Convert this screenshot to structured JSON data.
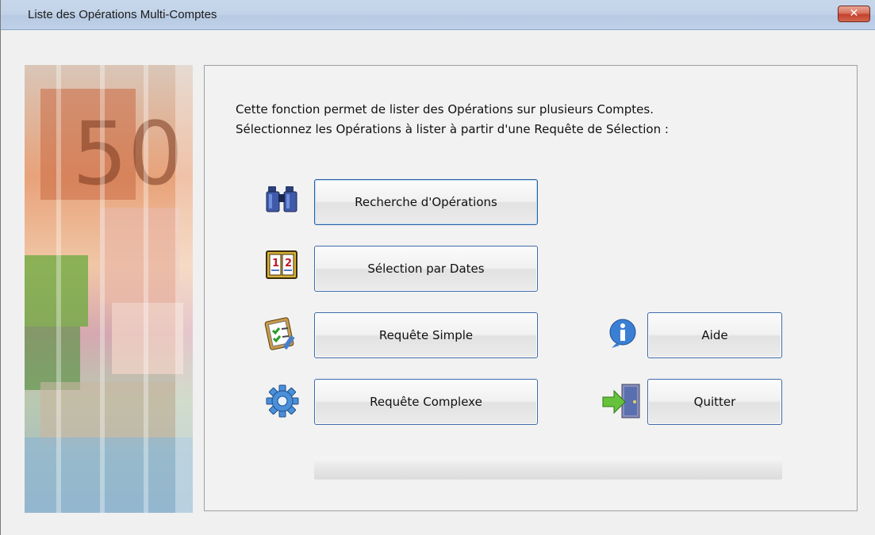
{
  "window": {
    "title": "Liste des Opérations Multi-Comptes",
    "close_label": "✕"
  },
  "intro": {
    "line1": "Cette fonction permet de lister des Opérations sur plusieurs Comptes.",
    "line2": "Sélectionnez les Opérations à lister à partir d'une Requête de Sélection :"
  },
  "buttons": {
    "recherche": "Recherche d'Opérations",
    "dates": "Sélection par Dates",
    "simple": "Requête Simple",
    "complexe": "Requête Complexe",
    "aide": "Aide",
    "quitter": "Quitter"
  },
  "icons": {
    "recherche": "binoculars-icon",
    "dates": "calendar-icon",
    "simple": "clipboard-checklist-icon",
    "complexe": "gear-icon",
    "aide": "info-icon",
    "quitter": "exit-door-icon"
  },
  "progress": {
    "value": 0
  },
  "colors": {
    "button_border": "#3c6ba8",
    "close_red": "#c3402c"
  }
}
